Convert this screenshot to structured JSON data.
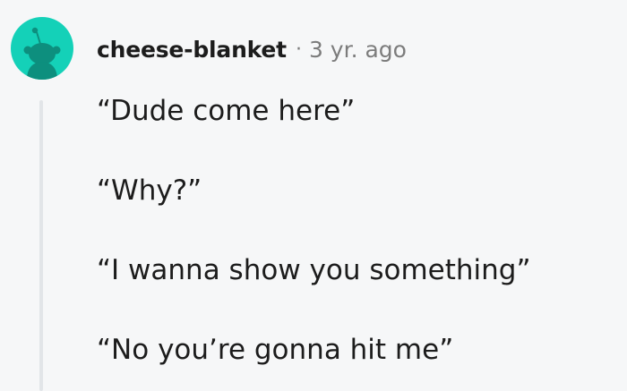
{
  "comment": {
    "username": "cheese-blanket",
    "separator": "·",
    "timestamp": "3 yr. ago",
    "avatar_icon": "snoo-avatar-icon",
    "avatar_color": "#14d1b8",
    "paragraphs": [
      "“Dude come here”",
      "“Why?”",
      "“I wanna show you something”",
      "“No you’re gonna hit me”"
    ]
  }
}
